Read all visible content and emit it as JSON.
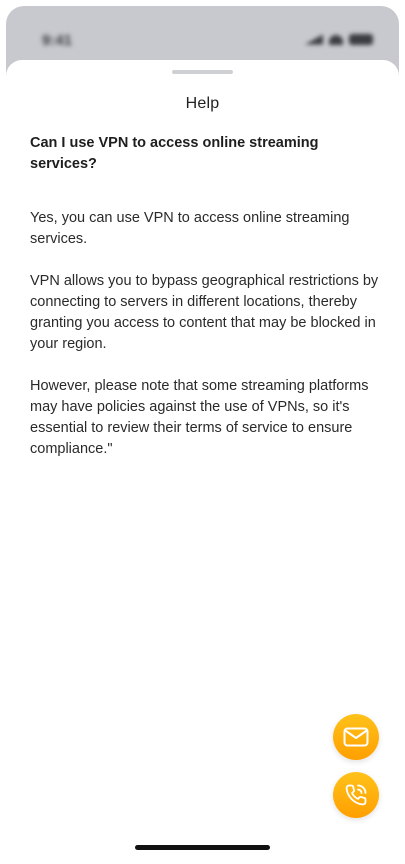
{
  "status_bar": {
    "time": "9:41"
  },
  "sheet": {
    "title": "Help",
    "question": "Can I use VPN to access online streaming services?",
    "answer": [
      "Yes, you can use VPN to access online streaming services.",
      "VPN allows you to bypass geographical restrictions by connecting to servers in different locations, thereby granting you access to content that may be blocked in your region.",
      "However, please note that some streaming platforms may have policies against the use of VPNs, so it's essential to review their terms of service to ensure compliance.\""
    ]
  },
  "actions": {
    "mail_icon": "mail-icon",
    "call_icon": "phone-icon",
    "accent_color": "#FFB000"
  }
}
